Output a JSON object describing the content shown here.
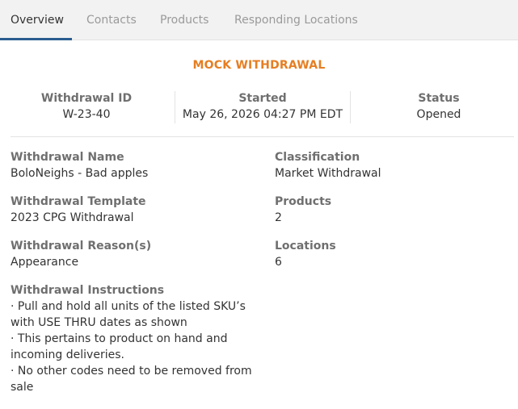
{
  "tabs": [
    {
      "label": "Overview",
      "active": true
    },
    {
      "label": "Contacts",
      "active": false
    },
    {
      "label": "Products",
      "active": false
    },
    {
      "label": "Responding Locations",
      "active": false
    }
  ],
  "banner": "MOCK WITHDRAWAL",
  "summary": {
    "withdrawal_id": {
      "label": "Withdrawal ID",
      "value": "W-23-40"
    },
    "started": {
      "label": "Started",
      "value": "May 26, 2026 04:27 PM EDT"
    },
    "status": {
      "label": "Status",
      "value": "Opened"
    }
  },
  "details": {
    "name": {
      "label": "Withdrawal Name",
      "value": "BoloNeighs - Bad apples"
    },
    "classification": {
      "label": "Classification",
      "value": "Market Withdrawal"
    },
    "template": {
      "label": "Withdrawal Template",
      "value": "2023 CPG Withdrawal"
    },
    "products": {
      "label": "Products",
      "value": "2"
    },
    "reasons": {
      "label": "Withdrawal Reason(s)",
      "value": "Appearance"
    },
    "locations": {
      "label": "Locations",
      "value": "6"
    },
    "instructions": {
      "label": "Withdrawal Instructions",
      "lines": [
        "· Pull and hold all units of the listed SKU’s",
        "with USE THRU dates as shown",
        "· This pertains to product on hand and",
        "incoming deliveries.",
        "· No other codes need to be removed from",
        "sale"
      ]
    }
  },
  "colors": {
    "accent": "#e67e22",
    "tab_underline": "#2a5d8f",
    "tab_bar_bg": "#f2f2f2",
    "label_gray": "#6f6f6f"
  }
}
